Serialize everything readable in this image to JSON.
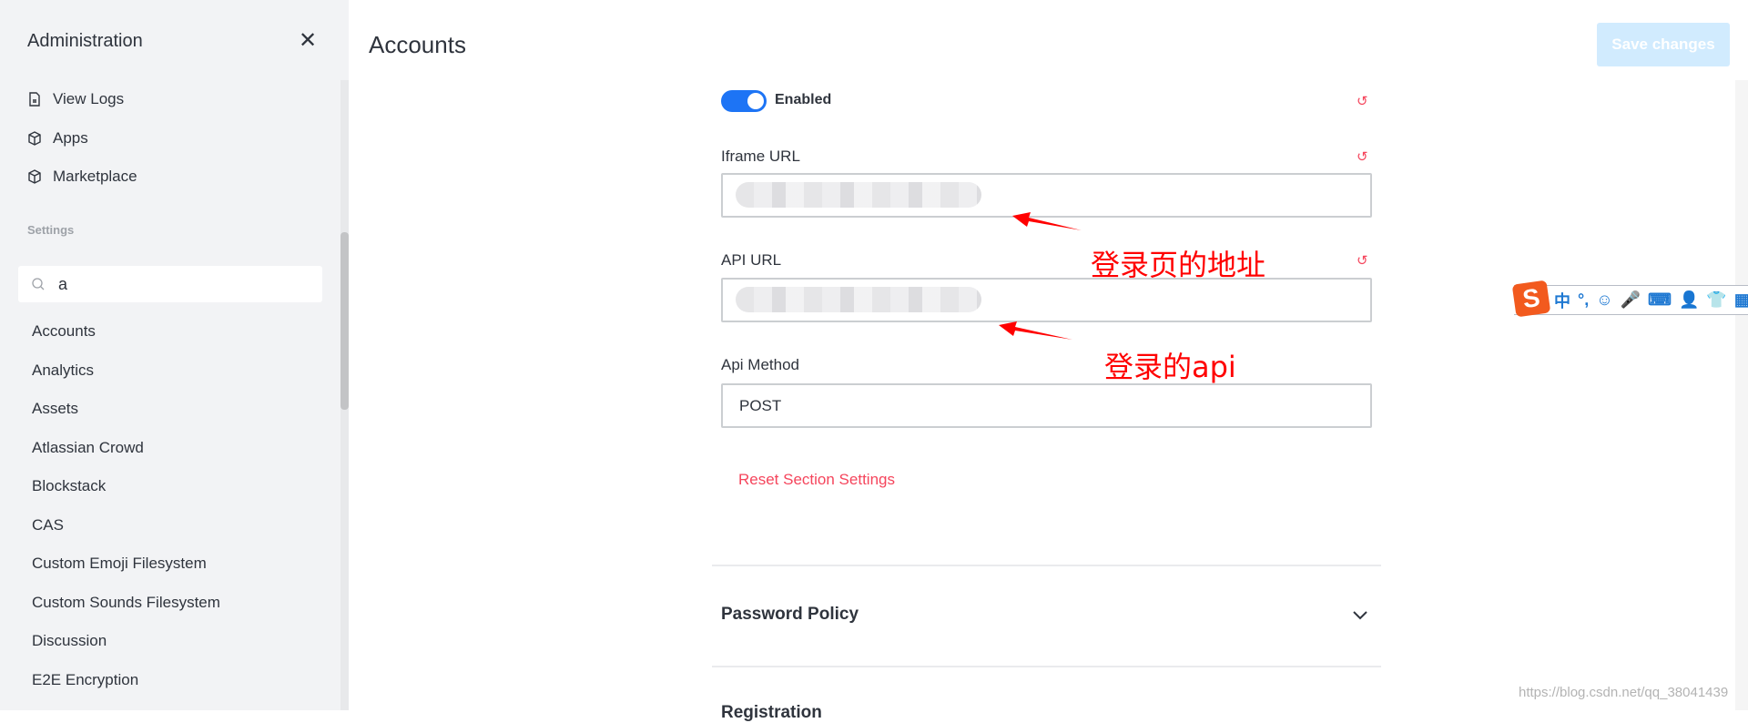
{
  "sidebar": {
    "title": "Administration",
    "nav": [
      {
        "label": "View Logs",
        "icon": "file-icon"
      },
      {
        "label": "Apps",
        "icon": "cube-icon"
      },
      {
        "label": "Marketplace",
        "icon": "cube-icon"
      }
    ],
    "settings_label": "Settings",
    "search_value": "a",
    "items": [
      "Accounts",
      "Analytics",
      "Assets",
      "Atlassian Crowd",
      "Blockstack",
      "CAS",
      "Custom Emoji Filesystem",
      "Custom Sounds Filesystem",
      "Discussion",
      "E2E Encryption"
    ]
  },
  "header": {
    "title": "Accounts",
    "save_label": "Save changes"
  },
  "form": {
    "enabled_label": "Enabled",
    "enabled": true,
    "iframe_label": "Iframe URL",
    "api_url_label": "API URL",
    "api_method_label": "Api Method",
    "api_method_value": "POST",
    "reset_section": "Reset Section Settings"
  },
  "sections": {
    "password_policy": "Password Policy",
    "registration": "Registration"
  },
  "annotations": {
    "iframe": "登录页的地址",
    "api": "登录的api"
  },
  "ime": {
    "items": [
      "中",
      "°,",
      "☺",
      "🎤",
      "⌨",
      "👤",
      "👕",
      "▦"
    ]
  },
  "watermark": "https://blog.csdn.net/qq_38041439",
  "colors": {
    "accent": "#1d74f5",
    "danger": "#f5455c",
    "save_disabled": "#d1ebfe",
    "annotation": "#ff0000"
  }
}
